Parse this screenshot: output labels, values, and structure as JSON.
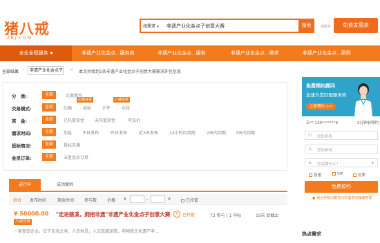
{
  "brand": {
    "logo": "猪八戒",
    "domain": "ZBJ.COM"
  },
  "search": {
    "type_label": "找需求",
    "query": "非遗产业化金点子创意大赛",
    "button": "搜索",
    "link": "搜服务",
    "post_button": "免费发需求"
  },
  "nav": {
    "all": "全业全程服务",
    "items": [
      "非遗产业化金点...服务商",
      "非遗产业化金点...服务",
      "非遗产业化金点...需求",
      "非遗产业化金点...案例"
    ]
  },
  "crumb": {
    "label": "全部结果",
    "tag": "非遗产业化金点子",
    "summary": "本次共找到1条非遗产业化金点子创意大赛需求外包信息"
  },
  "filters": [
    {
      "label": "分　类:",
      "active": "全部",
      "options": [
        "文案撰写"
      ]
    },
    {
      "label": "交易模式:",
      "active": "全部",
      "options": [
        "比稿",
        "招标",
        "计件",
        "众包"
      ],
      "subtags": [
        "比稿任务",
        "八戒任务"
      ]
    },
    {
      "label": "赏　金:",
      "active": "全部",
      "options": [
        "已托管赏金",
        "未托管赏金",
        "可议价"
      ]
    },
    {
      "label": "需求时间:",
      "active": "全部",
      "options": [
        "加急",
        "今日发布",
        "昨日发布",
        "近3天发布",
        "24小时内到期",
        "2天内到期",
        "3天内到期"
      ]
    },
    {
      "label": "投标情况:",
      "active": "全部",
      "options": [
        "投标未满"
      ]
    },
    {
      "label": "会员订单:",
      "active": "全部",
      "options": [
        "五星会员订单"
      ]
    }
  ],
  "tabs": {
    "active": "进行中",
    "other": "成功案例"
  },
  "sort": {
    "items": [
      "综合",
      "发布时间",
      "剩余时间",
      "参与数",
      "价格"
    ],
    "currency": "¥",
    "dash": "-",
    "unit": "¥",
    "checkbox": "已托管"
  },
  "task": {
    "price": "¥ 50000.00",
    "mode": "八戒任务",
    "title": "\"走进慈溪，拥抱非遗\"非遗产业化金点子创意大赛",
    "status_icon": "¥",
    "status": "已托管",
    "count": "72 参与 | 1 中标",
    "end": "19天 后截止",
    "desc": "一家餐饮企业，位于东海之滨，人杰地灵，人文底蕴深厚，非物质文化遗产丰..."
  },
  "side": {
    "banner_title": "免费预约顾问",
    "banner_sub": "急速为您匹配服务商",
    "banner_btn": "立即预约 >>",
    "stat_left": "天** 130*******8",
    "stat_right": "2分钟前预约",
    "phone_ph": "您的手机",
    "name_ph": "您的称呼",
    "need_ph": "您需要什么？",
    "check_urgent": "急速",
    "check_vip": "VIP",
    "check_quality": "优质",
    "submit": "免费预约",
    "note": "有合作顾问帮您分析需求对接服务商",
    "hot": "热点需求"
  },
  "colors": {
    "accent": "#f37b1d",
    "title_red": "#c0392b",
    "banner": "#2fa3c9"
  }
}
